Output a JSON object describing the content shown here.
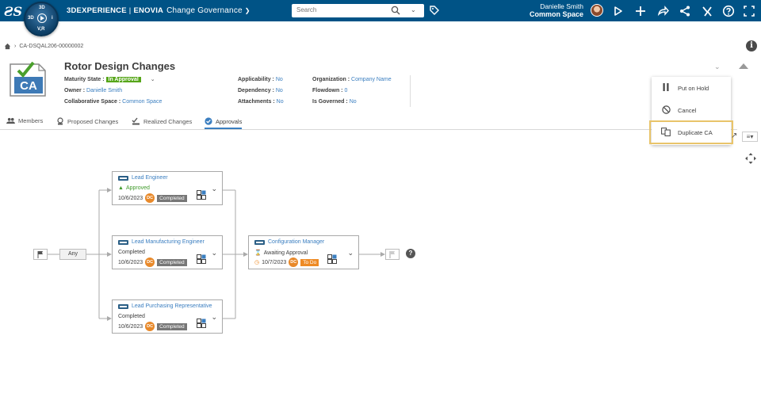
{
  "topbar": {
    "brand_bold": "3DEXPERIENCE",
    "brand_sep": "|",
    "brand_product": "ENOVIA",
    "app_name": "Change Governance",
    "compass": {
      "top": "3D",
      "left": "3D",
      "right": "i",
      "bottom": "V,R"
    },
    "search_placeholder": "Search",
    "user_name": "Danielle Smith",
    "space_name": "Common Space"
  },
  "breadcrumb": {
    "id": "CA-DSQAL206-00000002"
  },
  "header": {
    "icon_text": "CA",
    "title": "Rotor Design Changes",
    "col1": {
      "maturity_label": "Maturity State :",
      "maturity_value": "In Approval",
      "owner_label": "Owner :",
      "owner_value": "Danielle Smith",
      "space_label": "Collaborative Space :",
      "space_value": "Common Space"
    },
    "col2": {
      "applicability_label": "Applicability :",
      "applicability_value": "No",
      "dependency_label": "Dependency :",
      "dependency_value": "No",
      "attachments_label": "Attachments :",
      "attachments_value": "No"
    },
    "col3": {
      "organization_label": "Organization :",
      "organization_value": "Company Name",
      "flowdown_label": "Flowdown :",
      "flowdown_value": "0",
      "governed_label": "Is Governed :",
      "governed_value": "No"
    }
  },
  "tabs": [
    {
      "label": "Members"
    },
    {
      "label": "Proposed Changes"
    },
    {
      "label": "Realized Changes"
    },
    {
      "label": "Approvals"
    }
  ],
  "menu": {
    "items": [
      {
        "label": "Put on Hold"
      },
      {
        "label": "Cancel"
      },
      {
        "label": "Duplicate CA"
      }
    ]
  },
  "flow": {
    "any_label": "Any",
    "nodes": [
      {
        "role": "Lead Engineer",
        "status": "Approved",
        "date": "10/6/2023",
        "initials": "DC",
        "state": "Completed"
      },
      {
        "role": "Lead Manufacturing Engineer",
        "status": "Completed",
        "date": "10/6/2023",
        "initials": "DC",
        "state": "Completed"
      },
      {
        "role": "Lead Purchasing Representative",
        "status": "Completed",
        "date": "10/6/2023",
        "initials": "DC",
        "state": "Completed"
      },
      {
        "role": "Configuration Manager",
        "status": "Awaiting Approval",
        "date": "10/7/2023",
        "initials": "DC",
        "state": "To Do"
      }
    ]
  }
}
